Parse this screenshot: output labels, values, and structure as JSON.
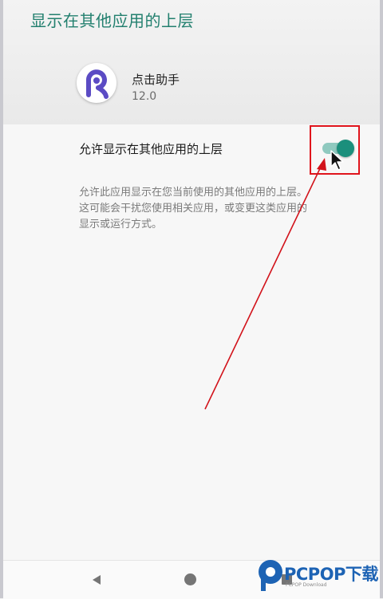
{
  "header": {
    "title": "显示在其他应用的上层"
  },
  "app": {
    "name": "点击助手",
    "version": "12.0",
    "icon": "app-logo-icon"
  },
  "permission": {
    "label": "允许显示在其他应用的上层",
    "enabled": true,
    "description_lines": [
      "允许此应用显示在您当前使用的其他应用的上层。",
      "这可能会干扰您使用相关应用，或变更这类应用的",
      "显示或运行方式。"
    ]
  },
  "navbar": {
    "back": "back-icon",
    "home": "home-icon",
    "recent": "recent-apps-icon"
  },
  "watermark": {
    "brand": "PCPOP下载",
    "sub": "PCPOP Download"
  },
  "colors": {
    "accent": "#1b8f7c",
    "title": "#23806f",
    "annotation": "#e0141c",
    "watermark": "#1d63b4"
  }
}
